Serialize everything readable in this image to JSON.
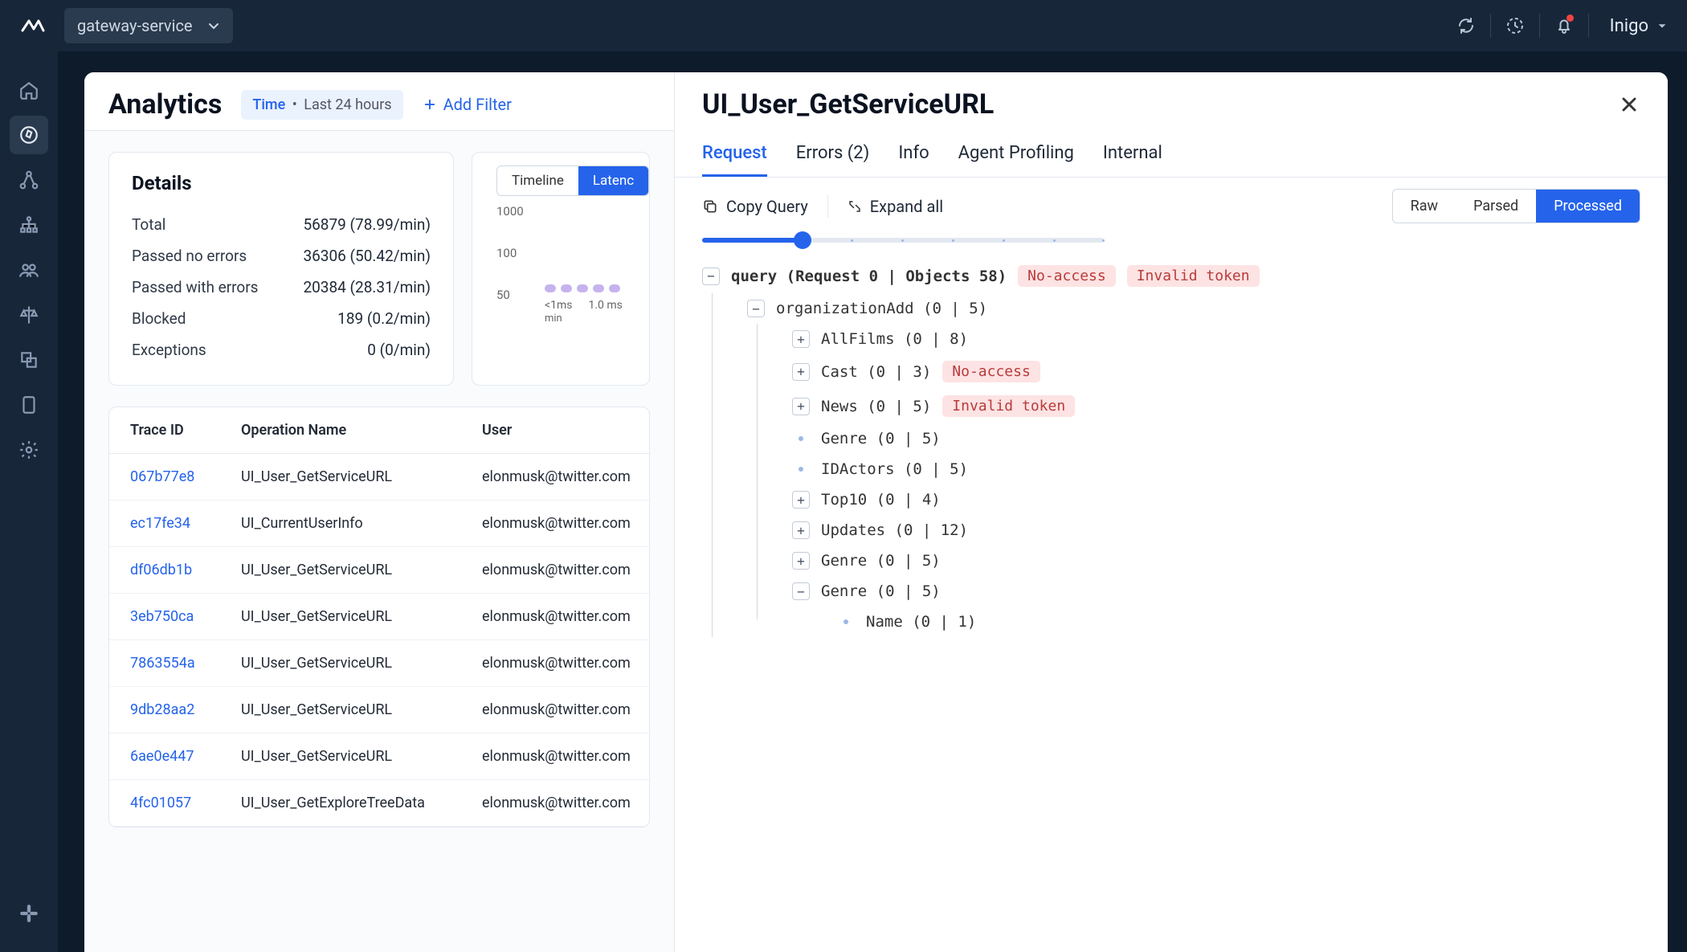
{
  "service_selector": "gateway-service",
  "user_name": "Inigo",
  "page_title": "Analytics",
  "time_filter": {
    "label": "Time",
    "value": "Last 24 hours"
  },
  "add_filter_label": "Add Filter",
  "details_card": {
    "title": "Details",
    "rows": [
      {
        "label": "Total",
        "value": "56879 (78.99/min)"
      },
      {
        "label": "Passed no errors",
        "value": "36306 (50.42/min)"
      },
      {
        "label": "Passed with errors",
        "value": "20384 (28.31/min)"
      },
      {
        "label": "Blocked",
        "value": "189 (0.2/min)"
      },
      {
        "label": "Exceptions",
        "value": "0 (0/min)"
      }
    ]
  },
  "chart_data": {
    "type": "bar",
    "segments": [
      "Timeline",
      "Latenc"
    ],
    "selected_segment": "Latenc",
    "y_ticks": [
      "1000",
      "100",
      "50"
    ],
    "x_ticks": [
      "<1ms",
      "1.0 ms"
    ],
    "x_sublabel": "min",
    "categories": [
      "<1ms",
      "1.0 ms"
    ],
    "values": [
      50,
      50
    ],
    "ylim": [
      0,
      1000
    ]
  },
  "table": {
    "headers": [
      "Trace ID",
      "Operation Name",
      "User"
    ],
    "rows": [
      {
        "trace": "067b77e8",
        "op": "UI_User_GetServiceURL",
        "user": "elonmusk@twitter.com"
      },
      {
        "trace": "ec17fe34",
        "op": "UI_CurrentUserInfo",
        "user": "elonmusk@twitter.com"
      },
      {
        "trace": "df06db1b",
        "op": "UI_User_GetServiceURL",
        "user": "elonmusk@twitter.com"
      },
      {
        "trace": "3eb750ca",
        "op": "UI_User_GetServiceURL",
        "user": "elonmusk@twitter.com"
      },
      {
        "trace": "7863554a",
        "op": "UI_User_GetServiceURL",
        "user": "elonmusk@twitter.com"
      },
      {
        "trace": "9db28aa2",
        "op": "UI_User_GetServiceURL",
        "user": "elonmusk@twitter.com"
      },
      {
        "trace": "6ae0e447",
        "op": "UI_User_GetServiceURL",
        "user": "elonmusk@twitter.com"
      },
      {
        "trace": "4fc01057",
        "op": "UI_User_GetExploreTreeData",
        "user": "elonmusk@twitter.com"
      }
    ]
  },
  "detail": {
    "title": "UI_User_GetServiceURL",
    "tabs": [
      {
        "label": "Request",
        "active": true
      },
      {
        "label": "Errors (2)"
      },
      {
        "label": "Info"
      },
      {
        "label": "Agent Profiling"
      },
      {
        "label": "Internal"
      }
    ],
    "toolbar": {
      "copy_label": "Copy Query",
      "expand_label": "Expand all",
      "views": [
        "Raw",
        "Parsed",
        "Processed"
      ],
      "selected_view": "Processed"
    },
    "tree": {
      "root": {
        "label": "query (Request 0 | Objects 58)",
        "badges": [
          "No-access",
          "Invalid token"
        ],
        "expanded": true
      },
      "org": {
        "label": "organizationAdd (0 | 5)",
        "expanded": true
      },
      "children": [
        {
          "label": "AllFilms (0 | 8)",
          "type": "plus"
        },
        {
          "label": "Cast (0 | 3)",
          "type": "plus",
          "badges": [
            "No-access"
          ]
        },
        {
          "label": "News (0 | 5)",
          "type": "plus",
          "badges": [
            "Invalid token"
          ]
        },
        {
          "label": "Genre (0 | 5)",
          "type": "dot"
        },
        {
          "label": "IDActors (0 | 5)",
          "type": "dot"
        },
        {
          "label": "Top10 (0 | 4)",
          "type": "plus"
        },
        {
          "label": "Updates (0 | 12)",
          "type": "plus"
        },
        {
          "label": "Genre (0 | 5)",
          "type": "plus"
        },
        {
          "label": "Genre (0 | 5)",
          "type": "minus",
          "children": [
            {
              "label": "Name (0 | 1)",
              "type": "dot"
            }
          ]
        }
      ]
    }
  }
}
